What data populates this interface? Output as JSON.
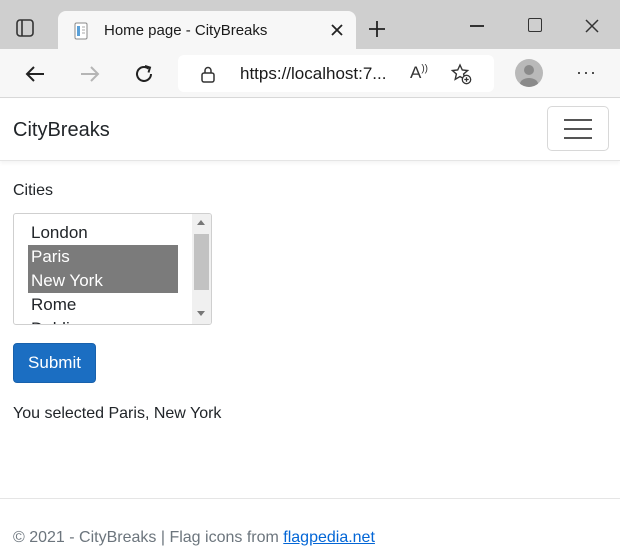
{
  "browser": {
    "tab_title": "Home page - CityBreaks",
    "url": "https://localhost:7...",
    "read_aloud_label": "Ầ"
  },
  "navbar": {
    "brand": "CityBreaks"
  },
  "form": {
    "label": "Cities",
    "options": [
      {
        "label": "London",
        "selected": false
      },
      {
        "label": "Paris",
        "selected": true
      },
      {
        "label": "New York",
        "selected": true
      },
      {
        "label": "Rome",
        "selected": false
      },
      {
        "label": "Dublin",
        "selected": false
      }
    ],
    "submit_label": "Submit"
  },
  "result": {
    "text": "You selected Paris, New York"
  },
  "footer": {
    "prefix": "© 2021 - CityBreaks | Flag icons from ",
    "link_text": "flagpedia.net"
  },
  "colors": {
    "primary_button": "#1b6ec2",
    "selected_option": "#7b7b7b",
    "link": "#0366d6"
  }
}
